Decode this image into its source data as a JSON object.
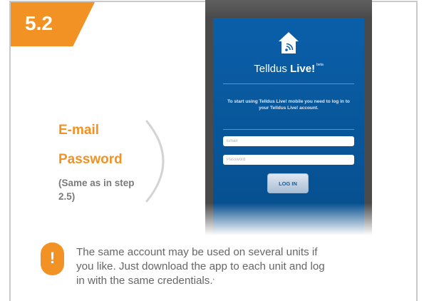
{
  "step": {
    "number": "5.2"
  },
  "labels": {
    "email": "E-mail",
    "password": "Password",
    "note": "(Same as in step 2.5)"
  },
  "phone_app": {
    "title_regular": "Telldus",
    "title_bold": "Live!",
    "title_mark": "beta",
    "intro_text": "To start using Telldus Live! mobile you need to log in to your Telldus Live! account.",
    "email_placeholder": "Email",
    "password_placeholder": "Password",
    "login_button": "LOG IN",
    "logo_icon": "house-wifi-icon"
  },
  "tip": {
    "icon_glyph": "!",
    "text": "The same account may be used on several units if you like. Just download the app to each unit and log in with the same credentials.",
    "footnote_mark": "*"
  },
  "colors": {
    "accent": "#f39224",
    "app_blue": "#0a5fa9",
    "text_gray": "#666666"
  }
}
